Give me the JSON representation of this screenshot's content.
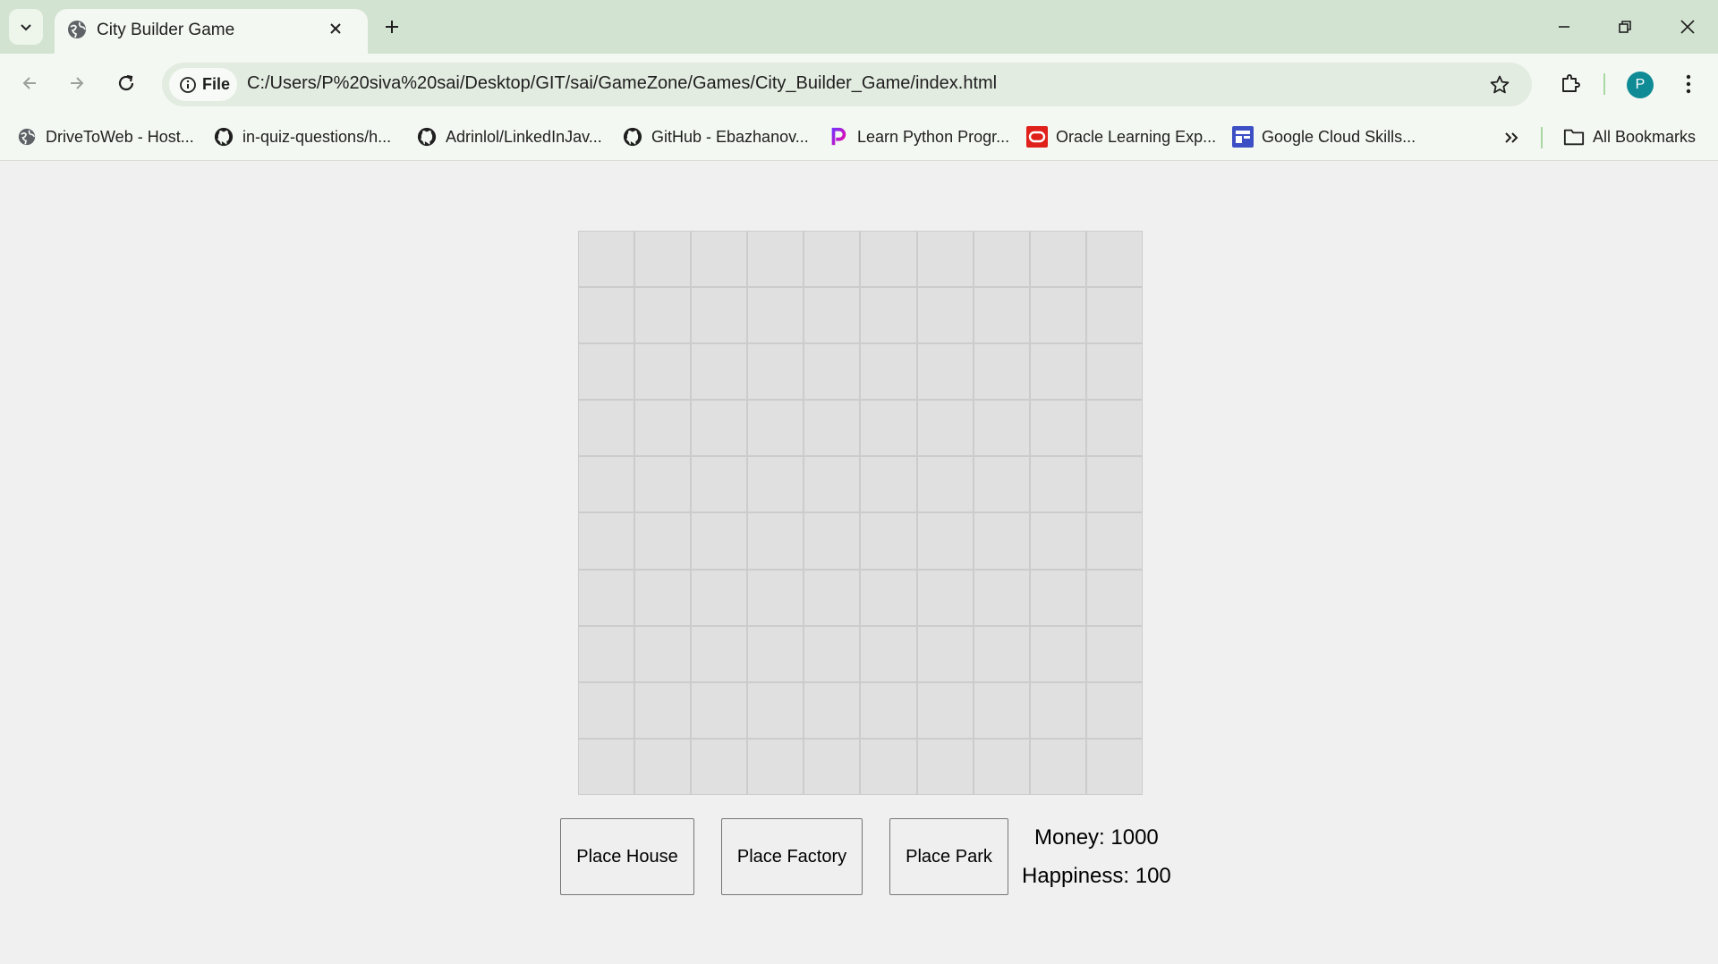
{
  "browser": {
    "tab_title": "City Builder Game",
    "file_chip_label": "File",
    "url": "C:/Users/P%20siva%20sai/Desktop/GIT/sai/GameZone/Games/City_Builder_Game/index.html",
    "profile_initial": "P",
    "accent_color": "#0f8b96",
    "bookmarks": [
      {
        "label": "DriveToWeb - Host...",
        "icon": "globe-icon"
      },
      {
        "label": "in-quiz-questions/h...",
        "icon": "github-icon"
      },
      {
        "label": "Adrinlol/LinkedInJav...",
        "icon": "github-icon"
      },
      {
        "label": "GitHub - Ebazhanov...",
        "icon": "github-icon"
      },
      {
        "label": "Learn Python Progr...",
        "icon": "python-course-icon"
      },
      {
        "label": "Oracle Learning Exp...",
        "icon": "oracle-icon"
      },
      {
        "label": "Google Cloud Skills...",
        "icon": "google-cloud-icon"
      }
    ],
    "all_bookmarks_label": "All Bookmarks"
  },
  "game": {
    "grid_rows": 10,
    "grid_cols": 10,
    "buttons": {
      "house": "Place House",
      "factory": "Place Factory",
      "park": "Place Park"
    },
    "money_text": "Money: 1000",
    "happiness_text": "Happiness: 100"
  }
}
